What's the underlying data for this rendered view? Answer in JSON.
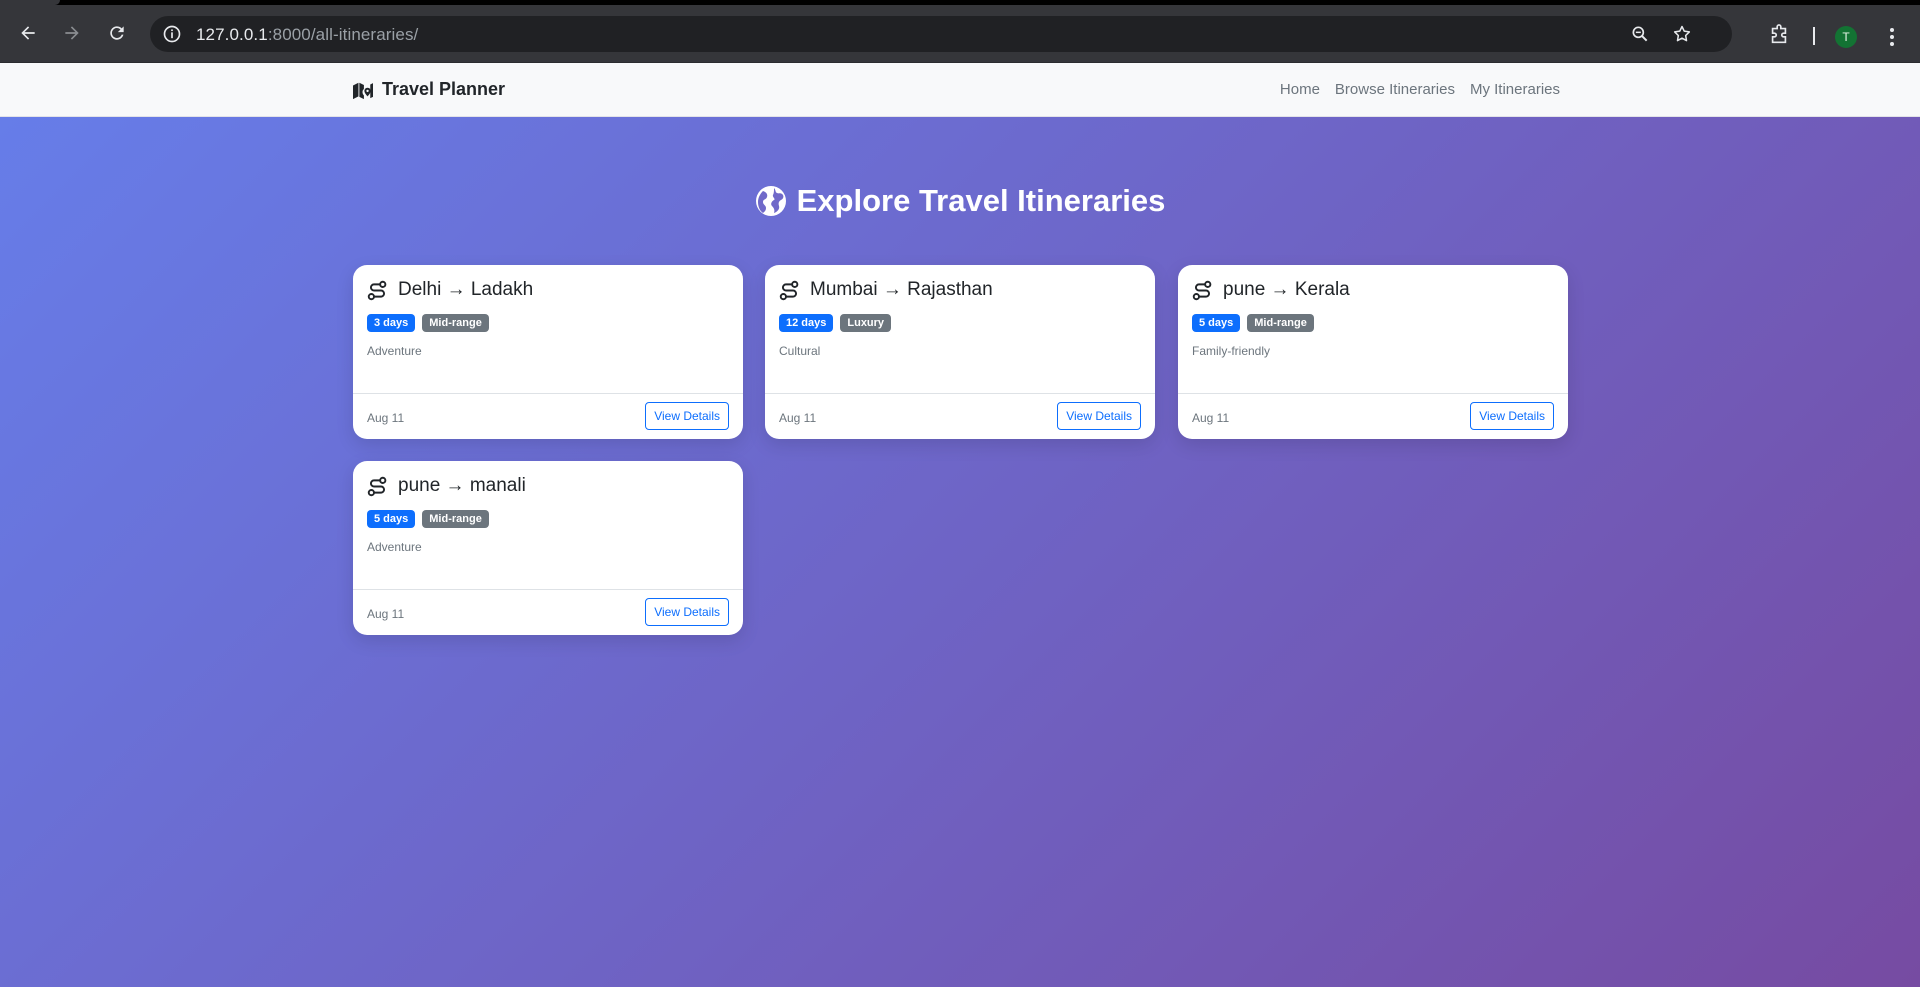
{
  "browser": {
    "url_host": "127.0.0.1",
    "url_path": ":8000/all-itineraries/",
    "profile_initial": "T"
  },
  "navbar": {
    "brand": "Travel Planner",
    "links": [
      "Home",
      "Browse Itineraries",
      "My Itineraries"
    ]
  },
  "page": {
    "heading": "Explore Travel Itineraries"
  },
  "itineraries": [
    {
      "title": "Delhi → Ladakh",
      "duration": "3 days",
      "budget": "Mid-range",
      "style": "Adventure",
      "date": "Aug 11",
      "button": "View Details"
    },
    {
      "title": "Mumbai → Rajasthan",
      "duration": "12 days",
      "budget": "Luxury",
      "style": "Cultural",
      "date": "Aug 11",
      "button": "View Details"
    },
    {
      "title": "pune → Kerala",
      "duration": "5 days",
      "budget": "Mid-range",
      "style": "Family-friendly",
      "date": "Aug 11",
      "button": "View Details"
    },
    {
      "title": "pune → manali",
      "duration": "5 days",
      "budget": "Mid-range",
      "style": "Adventure",
      "date": "Aug 11",
      "button": "View Details"
    }
  ],
  "colors": {
    "gradient_start": "#667eea",
    "gradient_end": "#764ba2",
    "primary": "#0d6efd",
    "secondary": "#6c757d"
  }
}
